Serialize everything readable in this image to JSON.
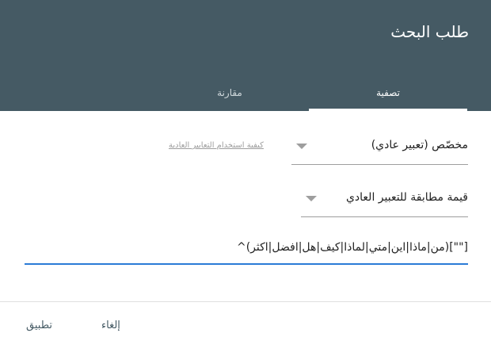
{
  "dialog": {
    "title": "طلب البحث",
    "tabs": [
      {
        "label": "تصفية",
        "active": true
      },
      {
        "label": "مقارنة",
        "active": false
      }
    ]
  },
  "form": {
    "filter_type": {
      "selected": "مخصّص (تعبير عادي)",
      "help_link": "كيفية استخدام التعابير العادية"
    },
    "match_mode": {
      "selected": "قيمة مطابقة للتعبير العادي"
    },
    "regex": {
      "value": "^(من|ماذا|اين|متي|لماذا|كيف|هل|افضل|اكثر)[\"\"]"
    }
  },
  "footer": {
    "apply_label": "تطبيق",
    "cancel_label": "إلغاء"
  },
  "colors": {
    "header": "#455a64",
    "accent": "#2b7bd6"
  }
}
